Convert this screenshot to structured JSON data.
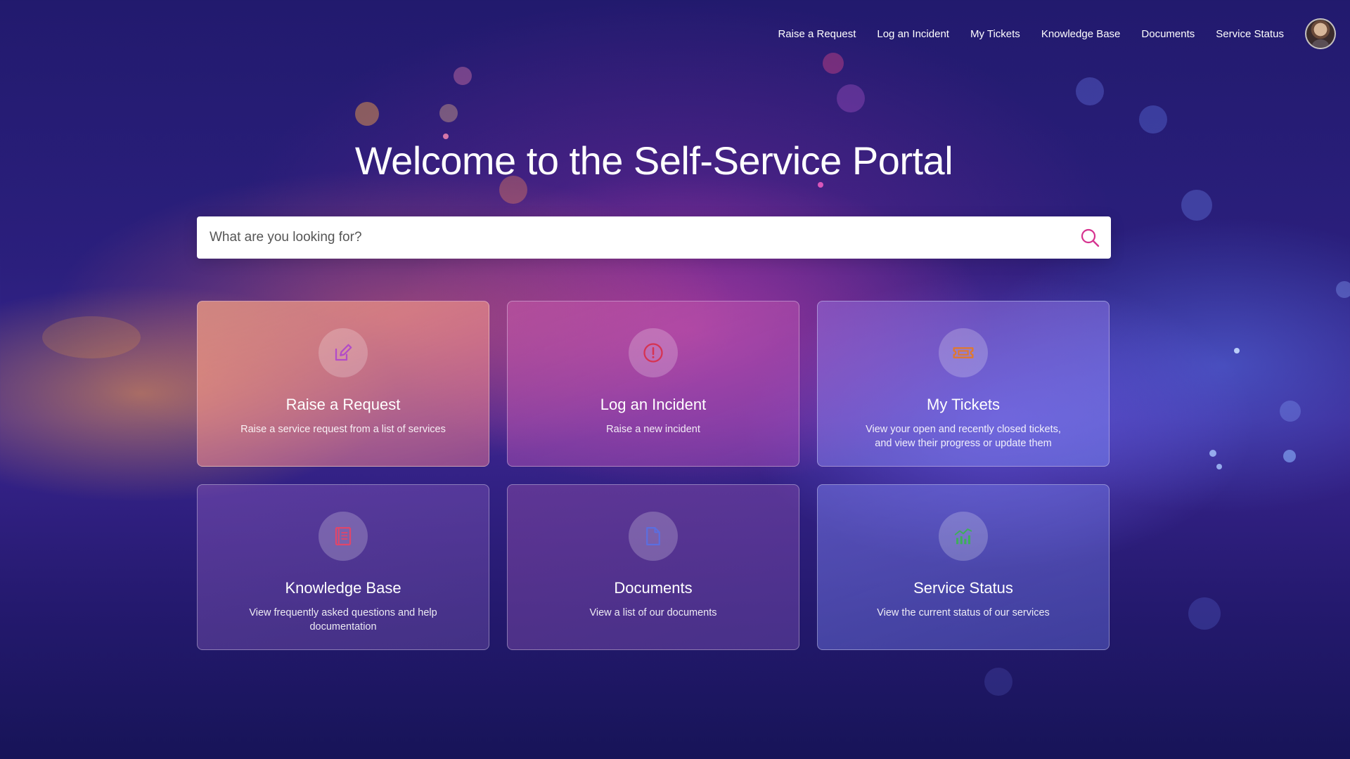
{
  "nav": {
    "links": [
      {
        "label": "Raise a Request"
      },
      {
        "label": "Log an Incident"
      },
      {
        "label": "My Tickets"
      },
      {
        "label": "Knowledge Base"
      },
      {
        "label": "Documents"
      },
      {
        "label": "Service Status"
      }
    ],
    "avatar_icon": "user-avatar"
  },
  "hero": {
    "title": "Welcome to the Self-Service Portal"
  },
  "search": {
    "placeholder": "What are you looking for?",
    "value": "",
    "icon": "search-icon",
    "icon_color": "#d6338f"
  },
  "cards": [
    {
      "title": "Raise a Request",
      "description": "Raise a service request from a list of services",
      "icon": "edit-icon",
      "icon_color": "#b24bc8"
    },
    {
      "title": "Log an Incident",
      "description": "Raise a new incident",
      "icon": "alert-circle-icon",
      "icon_color": "#d63352"
    },
    {
      "title": "My Tickets",
      "description": "View your open and recently closed tickets, and view their progress or update them",
      "icon": "ticket-icon",
      "icon_color": "#e0782f"
    },
    {
      "title": "Knowledge Base",
      "description": "View frequently asked questions and help documentation",
      "icon": "book-icon",
      "icon_color": "#e0466a"
    },
    {
      "title": "Documents",
      "description": "View a list of our documents",
      "icon": "document-icon",
      "icon_color": "#5b6ee0"
    },
    {
      "title": "Service Status",
      "description": "View the current status of our services",
      "icon": "chart-icon",
      "icon_color": "#3fae5b"
    }
  ]
}
